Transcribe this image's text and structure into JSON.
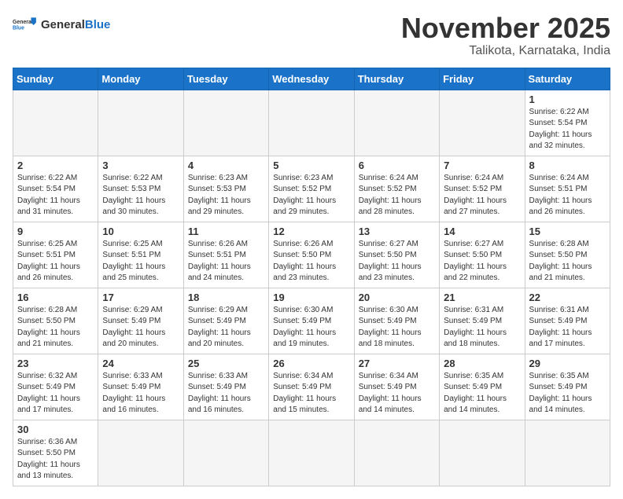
{
  "logo": {
    "text_general": "General",
    "text_blue": "Blue"
  },
  "title": "November 2025",
  "subtitle": "Talikota, Karnataka, India",
  "headers": [
    "Sunday",
    "Monday",
    "Tuesday",
    "Wednesday",
    "Thursday",
    "Friday",
    "Saturday"
  ],
  "days": [
    {
      "num": "",
      "info": ""
    },
    {
      "num": "",
      "info": ""
    },
    {
      "num": "",
      "info": ""
    },
    {
      "num": "",
      "info": ""
    },
    {
      "num": "",
      "info": ""
    },
    {
      "num": "",
      "info": ""
    },
    {
      "num": "1",
      "info": "Sunrise: 6:22 AM\nSunset: 5:54 PM\nDaylight: 11 hours\nand 32 minutes."
    }
  ],
  "week2": [
    {
      "num": "2",
      "info": "Sunrise: 6:22 AM\nSunset: 5:54 PM\nDaylight: 11 hours\nand 31 minutes."
    },
    {
      "num": "3",
      "info": "Sunrise: 6:22 AM\nSunset: 5:53 PM\nDaylight: 11 hours\nand 30 minutes."
    },
    {
      "num": "4",
      "info": "Sunrise: 6:23 AM\nSunset: 5:53 PM\nDaylight: 11 hours\nand 29 minutes."
    },
    {
      "num": "5",
      "info": "Sunrise: 6:23 AM\nSunset: 5:52 PM\nDaylight: 11 hours\nand 29 minutes."
    },
    {
      "num": "6",
      "info": "Sunrise: 6:24 AM\nSunset: 5:52 PM\nDaylight: 11 hours\nand 28 minutes."
    },
    {
      "num": "7",
      "info": "Sunrise: 6:24 AM\nSunset: 5:52 PM\nDaylight: 11 hours\nand 27 minutes."
    },
    {
      "num": "8",
      "info": "Sunrise: 6:24 AM\nSunset: 5:51 PM\nDaylight: 11 hours\nand 26 minutes."
    }
  ],
  "week3": [
    {
      "num": "9",
      "info": "Sunrise: 6:25 AM\nSunset: 5:51 PM\nDaylight: 11 hours\nand 26 minutes."
    },
    {
      "num": "10",
      "info": "Sunrise: 6:25 AM\nSunset: 5:51 PM\nDaylight: 11 hours\nand 25 minutes."
    },
    {
      "num": "11",
      "info": "Sunrise: 6:26 AM\nSunset: 5:51 PM\nDaylight: 11 hours\nand 24 minutes."
    },
    {
      "num": "12",
      "info": "Sunrise: 6:26 AM\nSunset: 5:50 PM\nDaylight: 11 hours\nand 23 minutes."
    },
    {
      "num": "13",
      "info": "Sunrise: 6:27 AM\nSunset: 5:50 PM\nDaylight: 11 hours\nand 23 minutes."
    },
    {
      "num": "14",
      "info": "Sunrise: 6:27 AM\nSunset: 5:50 PM\nDaylight: 11 hours\nand 22 minutes."
    },
    {
      "num": "15",
      "info": "Sunrise: 6:28 AM\nSunset: 5:50 PM\nDaylight: 11 hours\nand 21 minutes."
    }
  ],
  "week4": [
    {
      "num": "16",
      "info": "Sunrise: 6:28 AM\nSunset: 5:50 PM\nDaylight: 11 hours\nand 21 minutes."
    },
    {
      "num": "17",
      "info": "Sunrise: 6:29 AM\nSunset: 5:49 PM\nDaylight: 11 hours\nand 20 minutes."
    },
    {
      "num": "18",
      "info": "Sunrise: 6:29 AM\nSunset: 5:49 PM\nDaylight: 11 hours\nand 20 minutes."
    },
    {
      "num": "19",
      "info": "Sunrise: 6:30 AM\nSunset: 5:49 PM\nDaylight: 11 hours\nand 19 minutes."
    },
    {
      "num": "20",
      "info": "Sunrise: 6:30 AM\nSunset: 5:49 PM\nDaylight: 11 hours\nand 18 minutes."
    },
    {
      "num": "21",
      "info": "Sunrise: 6:31 AM\nSunset: 5:49 PM\nDaylight: 11 hours\nand 18 minutes."
    },
    {
      "num": "22",
      "info": "Sunrise: 6:31 AM\nSunset: 5:49 PM\nDaylight: 11 hours\nand 17 minutes."
    }
  ],
  "week5": [
    {
      "num": "23",
      "info": "Sunrise: 6:32 AM\nSunset: 5:49 PM\nDaylight: 11 hours\nand 17 minutes."
    },
    {
      "num": "24",
      "info": "Sunrise: 6:33 AM\nSunset: 5:49 PM\nDaylight: 11 hours\nand 16 minutes."
    },
    {
      "num": "25",
      "info": "Sunrise: 6:33 AM\nSunset: 5:49 PM\nDaylight: 11 hours\nand 16 minutes."
    },
    {
      "num": "26",
      "info": "Sunrise: 6:34 AM\nSunset: 5:49 PM\nDaylight: 11 hours\nand 15 minutes."
    },
    {
      "num": "27",
      "info": "Sunrise: 6:34 AM\nSunset: 5:49 PM\nDaylight: 11 hours\nand 14 minutes."
    },
    {
      "num": "28",
      "info": "Sunrise: 6:35 AM\nSunset: 5:49 PM\nDaylight: 11 hours\nand 14 minutes."
    },
    {
      "num": "29",
      "info": "Sunrise: 6:35 AM\nSunset: 5:49 PM\nDaylight: 11 hours\nand 14 minutes."
    }
  ],
  "week6": [
    {
      "num": "30",
      "info": "Sunrise: 6:36 AM\nSunset: 5:50 PM\nDaylight: 11 hours\nand 13 minutes."
    },
    {
      "num": "",
      "info": ""
    },
    {
      "num": "",
      "info": ""
    },
    {
      "num": "",
      "info": ""
    },
    {
      "num": "",
      "info": ""
    },
    {
      "num": "",
      "info": ""
    },
    {
      "num": "",
      "info": ""
    }
  ]
}
